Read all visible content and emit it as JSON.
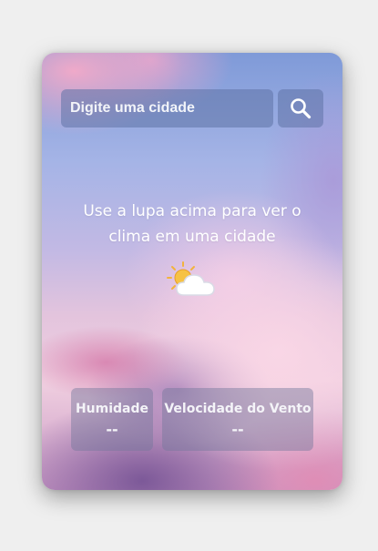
{
  "search": {
    "placeholder": "Digite uma cidade",
    "value": "",
    "button_icon": "search-icon"
  },
  "main": {
    "message": "Use a lupa acima para ver o clima em uma cidade",
    "weather_icon": "sun-behind-cloud-icon"
  },
  "stats": {
    "humidity": {
      "label": "Humidade",
      "value": "--"
    },
    "wind": {
      "label": "Velocidade do Vento",
      "value": "--"
    }
  },
  "colors": {
    "page_background": "#efefef",
    "text": "#ffffff",
    "panel": "#5f73a5"
  }
}
